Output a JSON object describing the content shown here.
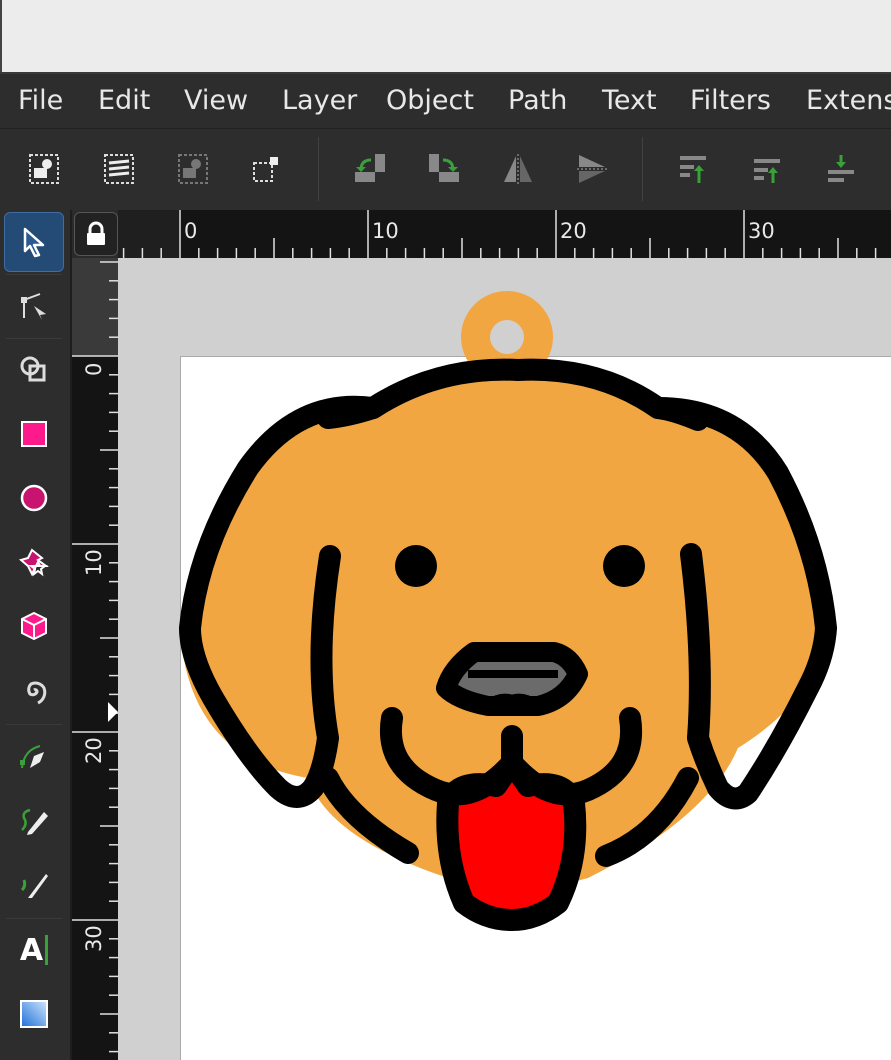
{
  "window": {
    "title": ""
  },
  "menu": {
    "items": [
      "File",
      "Edit",
      "View",
      "Layer",
      "Object",
      "Path",
      "Text",
      "Filters",
      "Extens"
    ]
  },
  "toolbar": {
    "buttons": [
      "select-all-icon",
      "select-all-in-all-layers-icon",
      "deselect-icon",
      "select-same-icon",
      "rotate-ccw-icon",
      "rotate-cw-icon",
      "flip-horizontal-icon",
      "flip-vertical-icon",
      "raise-to-top-icon",
      "raise-icon",
      "lower-icon"
    ]
  },
  "toolbox": {
    "tools": [
      {
        "name": "selector-tool",
        "icon": "arrow-icon",
        "active": true
      },
      {
        "name": "node-tool",
        "icon": "node-icon"
      },
      {
        "name": "shape-builder-tool",
        "icon": "shape-builder-icon"
      },
      {
        "name": "rectangle-tool",
        "icon": "rect-icon"
      },
      {
        "name": "ellipse-tool",
        "icon": "circle-icon"
      },
      {
        "name": "star-tool",
        "icon": "star-icon"
      },
      {
        "name": "3d-box-tool",
        "icon": "box3d-icon"
      },
      {
        "name": "spiral-tool",
        "icon": "spiral-icon"
      },
      {
        "name": "pen-tool",
        "icon": "pen-icon"
      },
      {
        "name": "pencil-tool",
        "icon": "pencil-icon"
      },
      {
        "name": "calligraphy-tool",
        "icon": "calligraphy-icon"
      },
      {
        "name": "text-tool",
        "icon": "text-icon",
        "label": "A"
      },
      {
        "name": "gradient-tool",
        "icon": "gradient-icon"
      }
    ]
  },
  "ruler": {
    "horizontal_labels": [
      "0",
      "10",
      "20",
      "30"
    ],
    "vertical_labels": [
      "0",
      "10",
      "20",
      "30"
    ]
  },
  "colors": {
    "accent": "#244a76",
    "dog_fill": "#f2a641",
    "outline": "#000000",
    "tongue": "#ff0000",
    "nose": "#6b6b6b",
    "canvas": "#d0d0d0",
    "page": "#ffffff"
  }
}
